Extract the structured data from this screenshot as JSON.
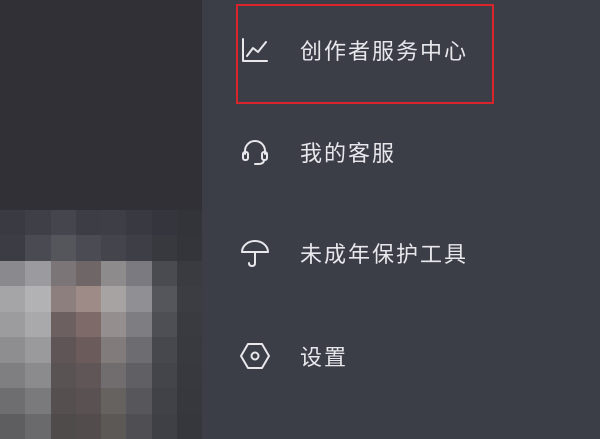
{
  "menu": {
    "items": [
      {
        "label": "创作者服务中心",
        "icon": "chart-line-icon"
      },
      {
        "label": "我的客服",
        "icon": "headset-icon"
      },
      {
        "label": "未成年保护工具",
        "icon": "umbrella-icon"
      },
      {
        "label": "设置",
        "icon": "settings-hexagon-icon"
      }
    ]
  },
  "colors": {
    "drawer_bg": "#3b3d47",
    "backdrop_bg": "#303036",
    "text": "#e8e8ec",
    "highlight": "#d8252c"
  }
}
